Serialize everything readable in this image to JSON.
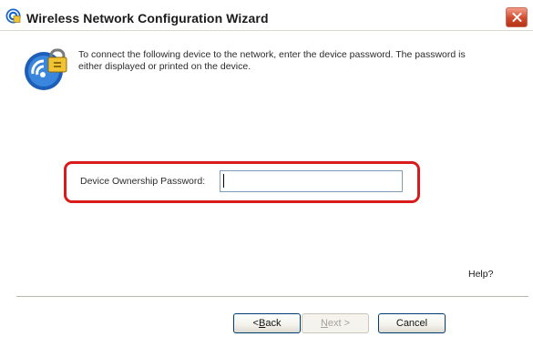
{
  "window": {
    "title": "Wireless Network Configuration Wizard",
    "close_icon": "close-icon"
  },
  "content": {
    "instructions": "To connect the following device to the network, enter the device password. The password is either displayed or printed on the device.",
    "wizard_icon": "wireless-lock-icon",
    "password_label": "Device Ownership Password:",
    "password_value": "",
    "highlight_color": "#d81c1c"
  },
  "footer": {
    "help_label": "Help?",
    "back_accel": "B",
    "back_rest": "ack",
    "back_prefix": "< ",
    "next_accel": "N",
    "next_rest": "ext >",
    "next_enabled": false,
    "cancel_label": "Cancel"
  }
}
